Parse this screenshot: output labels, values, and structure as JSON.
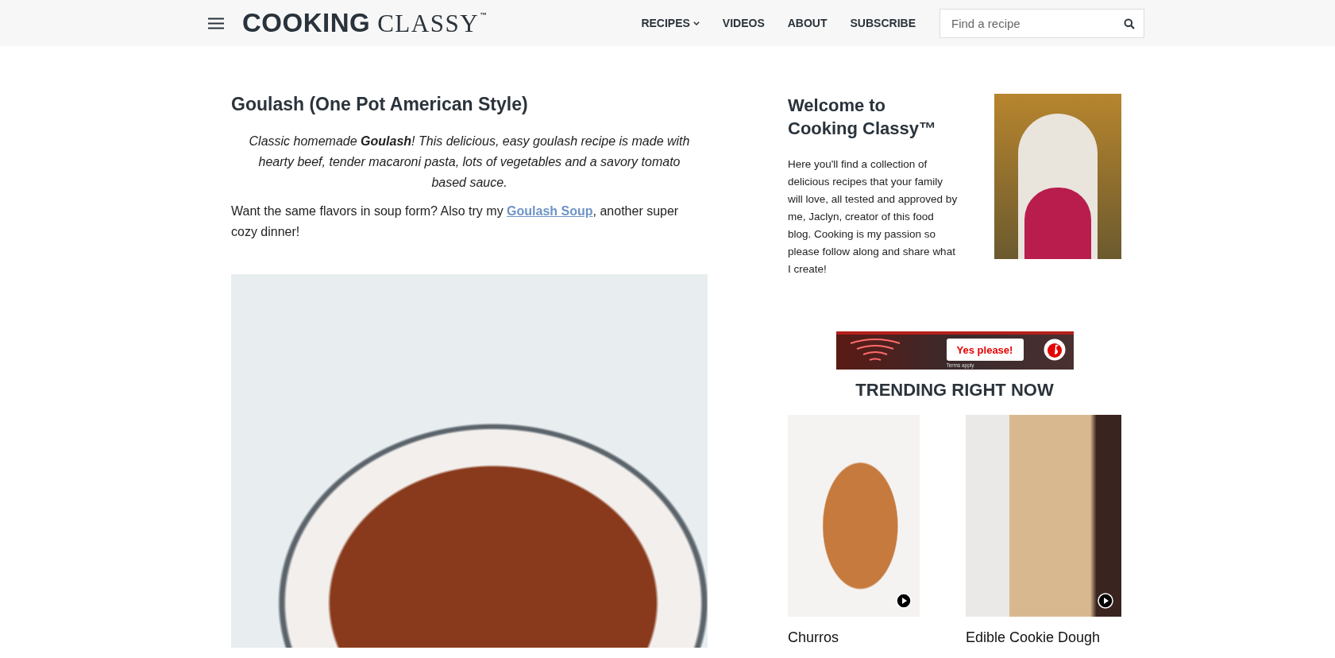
{
  "header": {
    "logo": {
      "bold_part": "COOKING",
      "serif_part": "CLASSY",
      "mark": "™"
    },
    "nav": [
      {
        "label": "RECIPES",
        "has_dropdown": true
      },
      {
        "label": "VIDEOS",
        "has_dropdown": false
      },
      {
        "label": "ABOUT",
        "has_dropdown": false
      },
      {
        "label": "SUBSCRIBE",
        "has_dropdown": false
      }
    ],
    "search": {
      "placeholder": "Find a recipe"
    }
  },
  "article": {
    "title": "Goulash (One Pot American Style)",
    "intro": "Classic homemade **Goulash**! This delicious, easy goulash recipe is made with hearty beef, tender macaroni pasta, lots of vegetables and a savory tomato based sauce.",
    "note": {
      "before": "Want the same flavors in soup form? Also try my ",
      "link": "Goulash Soup",
      "after": ", another super cozy dinner!"
    }
  },
  "sidebar": {
    "welcome_title": "Welcome to Cooking Classy™",
    "welcome_text": "Here you'll find a collection of delicious recipes that your family will love, all tested and approved by me, Jaclyn, creator of this food blog. Cooking is my passion so please follow along and share what I create!",
    "ad": {
      "button": "Yes please!",
      "fine_print": "Terms apply"
    },
    "trending_title": "TRENDING RIGHT NOW",
    "trending": [
      {
        "title": "Churros",
        "has_video": true
      },
      {
        "title": "Edible Cookie Dough",
        "has_video": true
      }
    ]
  }
}
